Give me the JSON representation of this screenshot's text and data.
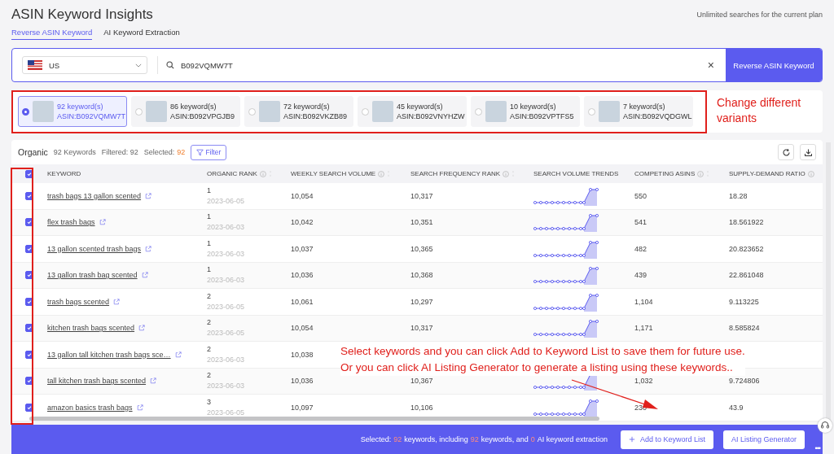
{
  "header": {
    "title": "ASIN Keyword Insights",
    "plan_note": "Unlimited searches for the current plan",
    "tabs": [
      {
        "label": "Reverse ASIN Keyword",
        "selected": true
      },
      {
        "label": "AI Keyword Extraction",
        "selected": false
      }
    ]
  },
  "search": {
    "country": "US",
    "value": "B092VQMW7T",
    "clear": "×",
    "button": "Reverse ASIN Keyword"
  },
  "variants": [
    {
      "count": "92 keyword(s)",
      "asin": "ASIN:B092VQMW7T",
      "selected": true
    },
    {
      "count": "86 keyword(s)",
      "asin": "ASIN:B092VPGJB9",
      "selected": false
    },
    {
      "count": "72 keyword(s)",
      "asin": "ASIN:B092VKZB89",
      "selected": false
    },
    {
      "count": "45 keyword(s)",
      "asin": "ASIN:B092VNYHZW",
      "selected": false
    },
    {
      "count": "10 keyword(s)",
      "asin": "ASIN:B092VPTFS5",
      "selected": false
    },
    {
      "count": "7 keyword(s)",
      "asin": "ASIN:B092VQDGWL",
      "selected": false
    }
  ],
  "toolbar": {
    "section": "Organic",
    "keywords": "92 Keywords",
    "filtered": "Filtered: 92",
    "selected_label": "Selected:",
    "selected_count": "92",
    "filter_button": "Filter"
  },
  "table": {
    "all_checked": true,
    "columns": [
      {
        "label": "KEYWORD",
        "kind": "plain"
      },
      {
        "label": "ORGANIC RANK",
        "kind": "sortable"
      },
      {
        "label": "WEEKLY SEARCH VOLUME",
        "kind": "sortable"
      },
      {
        "label": "SEARCH FREQUENCY RANK",
        "kind": "sortable"
      },
      {
        "label": "SEARCH VOLUME TRENDS",
        "kind": "plain"
      },
      {
        "label": "COMPETING ASINS",
        "kind": "sortable"
      },
      {
        "label": "SUPPLY-DEMAND RATIO",
        "kind": "info"
      }
    ],
    "rows": [
      {
        "checked": true,
        "keyword": "trash bags 13 gallon scented",
        "rank": "1",
        "date": "2023-06-05",
        "weekly": "10,054",
        "frequency": "10,317",
        "competing": "550",
        "ratio": "18.28"
      },
      {
        "checked": true,
        "keyword": "flex trash bags",
        "rank": "1",
        "date": "2023-06-03",
        "weekly": "10,042",
        "frequency": "10,351",
        "competing": "541",
        "ratio": "18.561922"
      },
      {
        "checked": true,
        "keyword": "13 gallon scented trash bags",
        "rank": "1",
        "date": "2023-06-03",
        "weekly": "10,037",
        "frequency": "10,365",
        "competing": "482",
        "ratio": "20.823652"
      },
      {
        "checked": true,
        "keyword": "13 gallon trash bag scented",
        "rank": "1",
        "date": "2023-06-03",
        "weekly": "10,036",
        "frequency": "10,368",
        "competing": "439",
        "ratio": "22.861048"
      },
      {
        "checked": true,
        "keyword": "trash bags scented",
        "rank": "2",
        "date": "2023-06-05",
        "weekly": "10,061",
        "frequency": "10,297",
        "competing": "1,104",
        "ratio": "9.113225"
      },
      {
        "checked": true,
        "keyword": "kitchen trash bags scented",
        "rank": "2",
        "date": "2023-06-05",
        "weekly": "10,054",
        "frequency": "10,317",
        "competing": "1,171",
        "ratio": "8.585824"
      },
      {
        "checked": true,
        "keyword": "13 gallon tall kitchen trash bags sce…",
        "rank": "2",
        "date": "2023-06-03",
        "weekly": "10,038"
      },
      {
        "checked": true,
        "keyword": "tall kitchen trash bags scented",
        "rank": "2",
        "date": "2023-06-03",
        "weekly": "10,036",
        "frequency": "10,367",
        "competing": "1,032",
        "ratio": "9.724806"
      },
      {
        "checked": true,
        "keyword": "amazon basics trash bags",
        "rank": "3",
        "date": "2023-06-05",
        "weekly": "10,097",
        "frequency": "10,106",
        "competing": "230",
        "ratio": "43.9"
      }
    ]
  },
  "footer": {
    "segments": [
      {
        "kind": "text",
        "text": "Selected:"
      },
      {
        "kind": "count",
        "text": "92"
      },
      {
        "kind": "text",
        "text": "keywords, including"
      },
      {
        "kind": "count",
        "text": "92"
      },
      {
        "kind": "text",
        "text": "keywords, and"
      },
      {
        "kind": "count",
        "text": "0"
      },
      {
        "kind": "text",
        "text": "AI keyword extraction"
      }
    ],
    "add_button": "Add to Keyword List",
    "generator_button": "AI Listing Generator",
    "more": "•••"
  },
  "annotations": {
    "variants_note": "Change different variants",
    "keywords_note": [
      "Select keywords and you can click Add to Keyword List to save them for future use.",
      "Or you can click AI Listing Generator to generate a listing using these keywords.."
    ]
  }
}
